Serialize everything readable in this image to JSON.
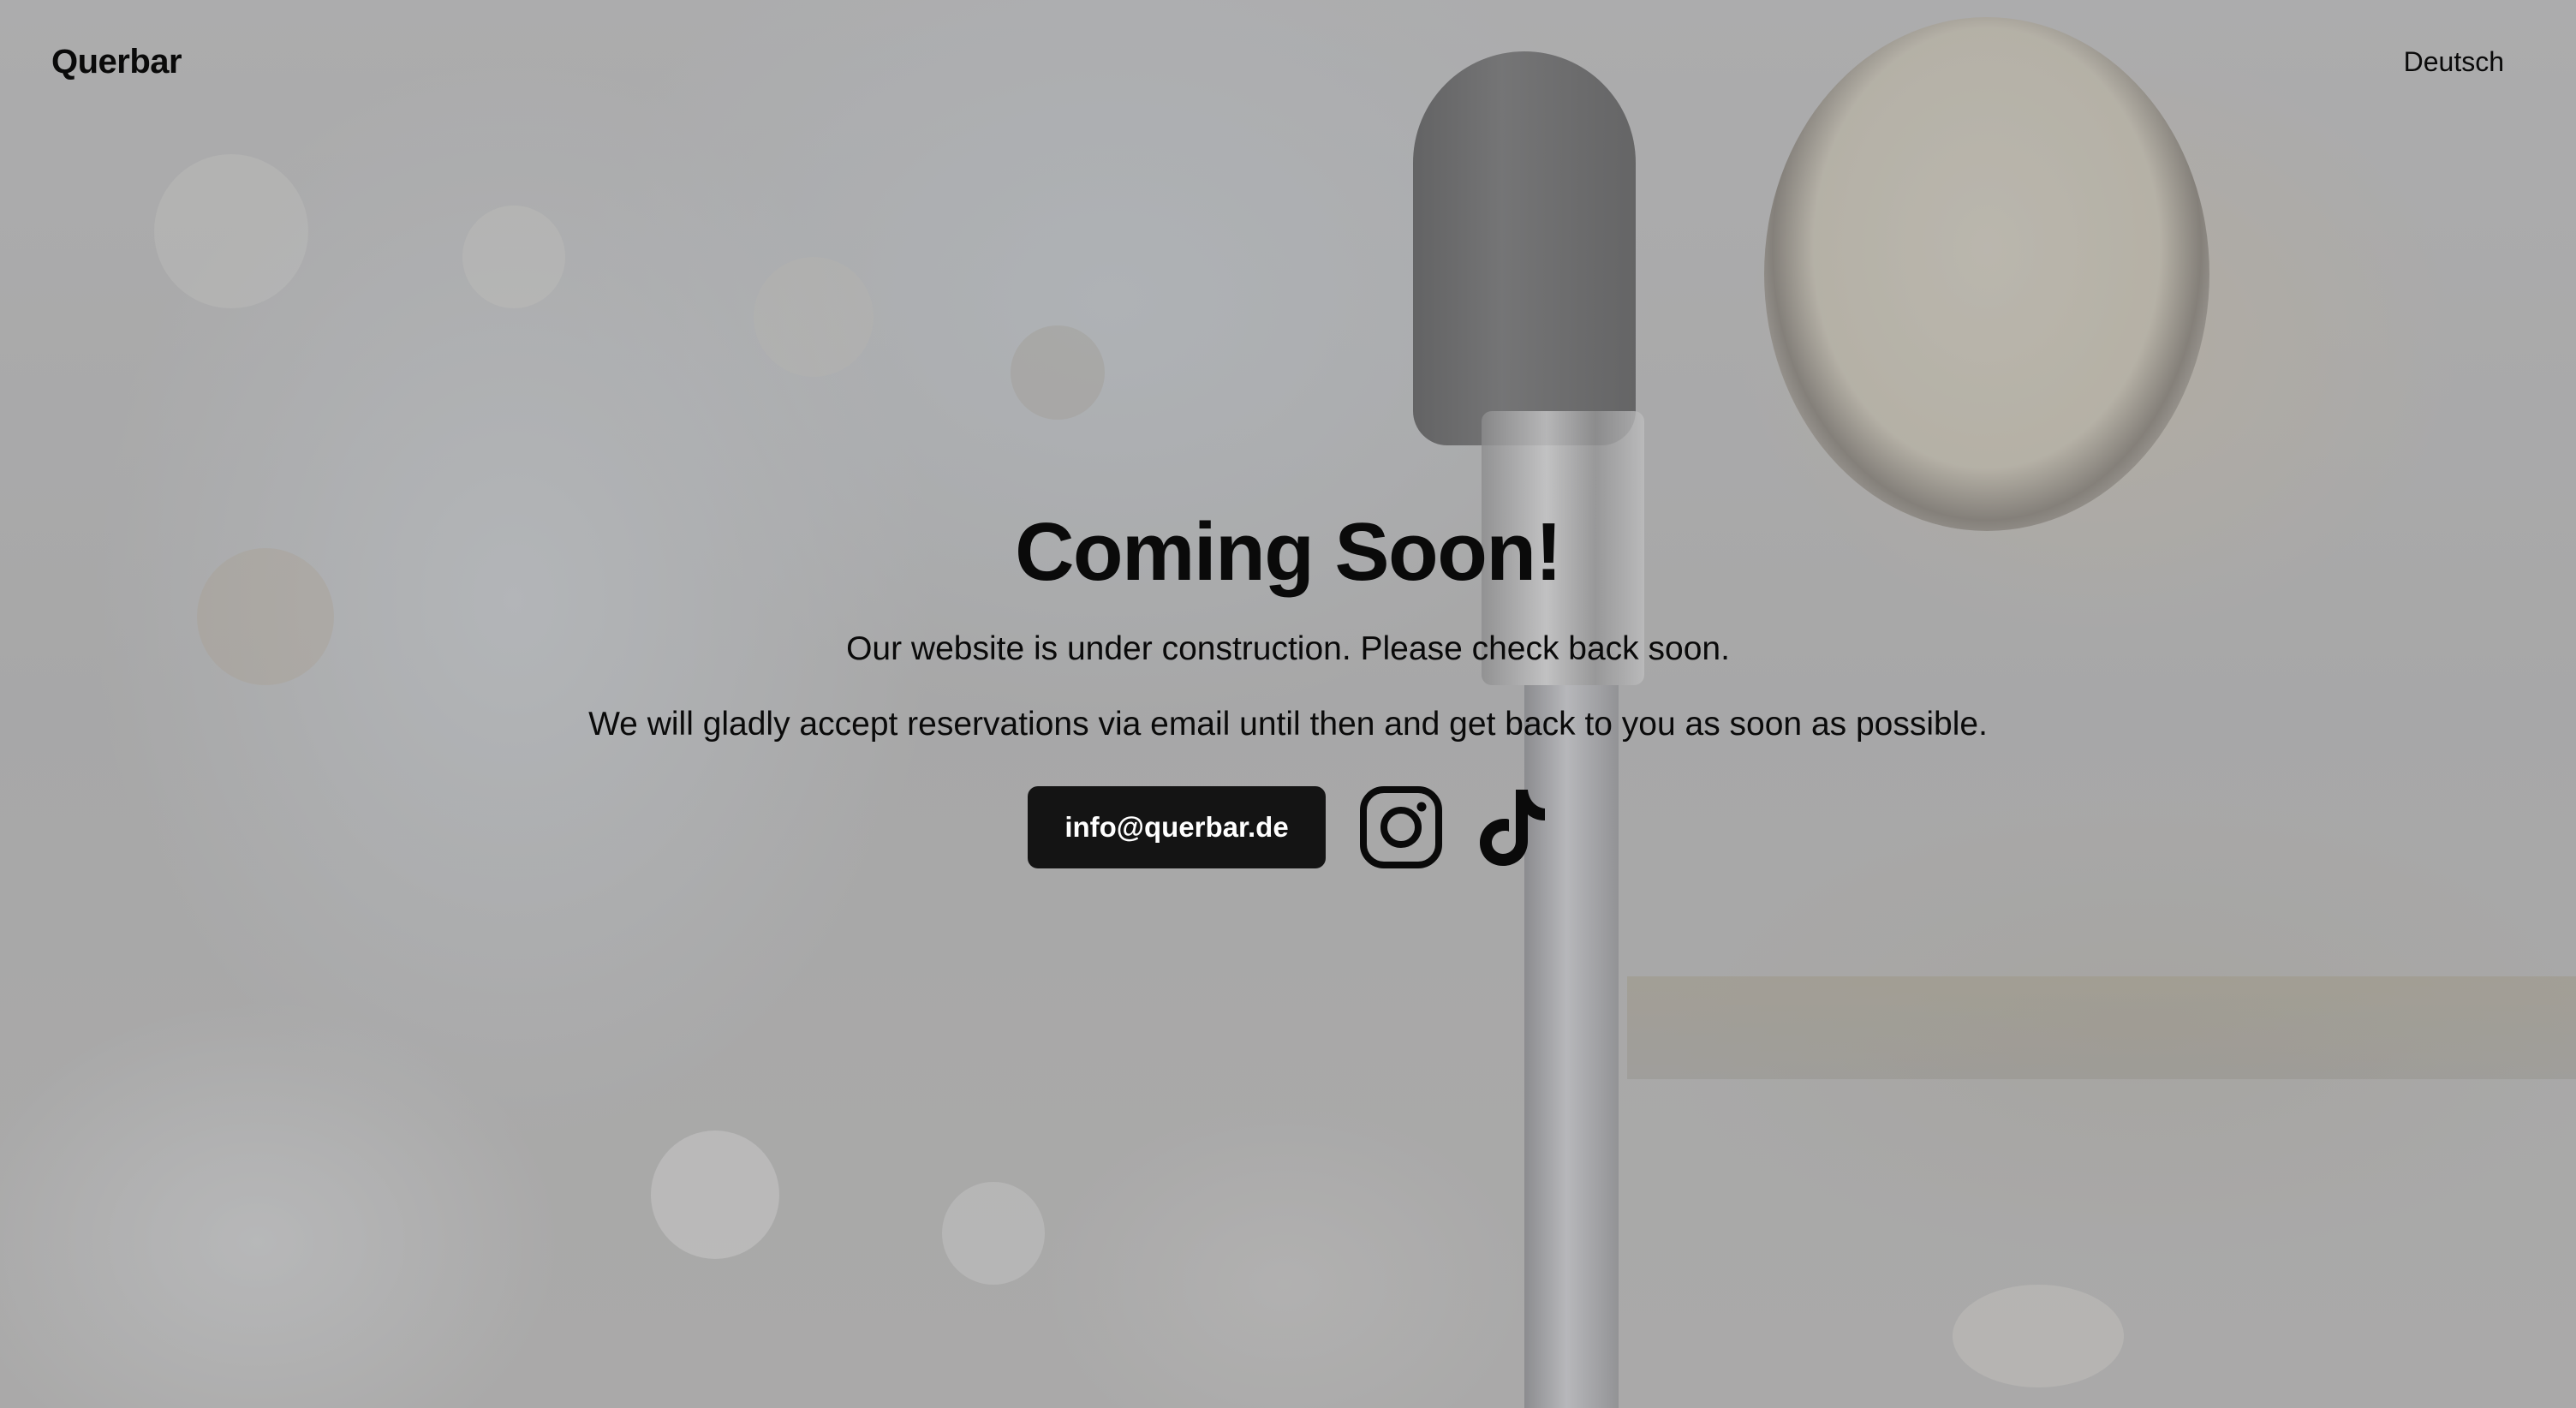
{
  "header": {
    "brand": "Querbar",
    "language_link": "Deutsch"
  },
  "main": {
    "title": "Coming Soon!",
    "message_1": "Our website is under construction. Please check back soon.",
    "message_2": "We will gladly accept reservations via email until then and get back to you as soon as possible.",
    "email_button": "info@querbar.de",
    "social": [
      {
        "name": "instagram-icon"
      },
      {
        "name": "tiktok-icon"
      }
    ]
  },
  "colors": {
    "text": "#0a0a0a",
    "button_bg": "#141414",
    "button_text": "#ffffff"
  }
}
